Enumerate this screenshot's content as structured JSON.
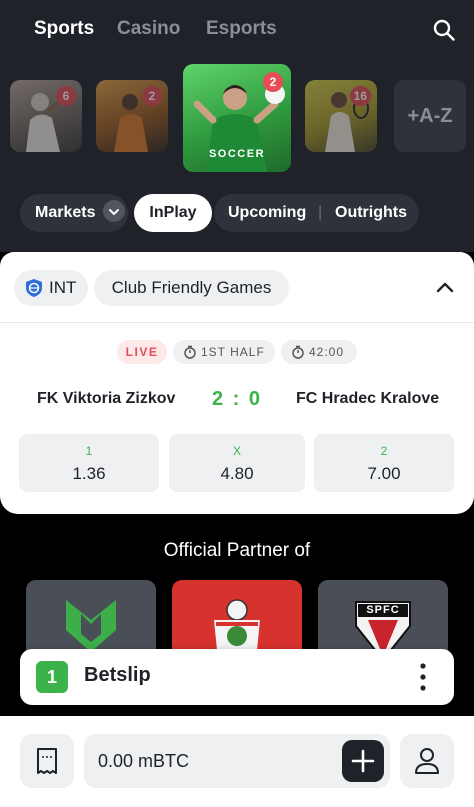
{
  "nav": {
    "tabs": [
      "Sports",
      "Casino",
      "Esports"
    ],
    "active_tab": "Sports"
  },
  "sports": {
    "items": [
      {
        "name": "baseball",
        "count": "6"
      },
      {
        "name": "basketball",
        "count": "2"
      },
      {
        "name": "soccer",
        "label": "SOCCER",
        "count": "2",
        "active": true
      },
      {
        "name": "tennis",
        "count": "16"
      }
    ],
    "az_label": "+A-Z"
  },
  "filters": {
    "markets": "Markets",
    "inplay": "InPlay",
    "upcoming": "Upcoming",
    "outrights": "Outrights",
    "separator": "|"
  },
  "match": {
    "region": "INT",
    "competition": "Club Friendly Games",
    "status": "LIVE",
    "period": "1ST HALF",
    "clock": "42:00",
    "home": "FK Viktoria Zizkov",
    "away": "FC Hradec Kralove",
    "score": "2 : 0",
    "odds": [
      {
        "label": "1",
        "value": "1.36"
      },
      {
        "label": "X",
        "value": "4.80"
      },
      {
        "label": "2",
        "value": "7.00"
      }
    ]
  },
  "partners": {
    "title": "Official Partner of",
    "spfc_text": "SPFC"
  },
  "betslip": {
    "count": "1",
    "label": "Betslip"
  },
  "wallet": {
    "balance": "0.00 mBTC"
  },
  "colors": {
    "header_bg": "#1f2228",
    "accent_green": "#3cb34a",
    "badge_red": "#e74c57",
    "card_bg": "#ffffff"
  }
}
